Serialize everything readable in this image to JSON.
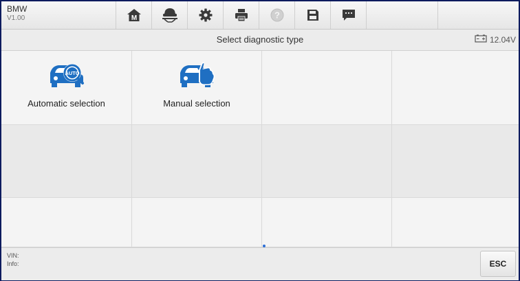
{
  "header": {
    "vehicle": "BMW",
    "version": "V1.00",
    "buttons": [
      {
        "icon": "home-icon"
      },
      {
        "icon": "vehicle-lift-icon"
      },
      {
        "icon": "gear-icon"
      },
      {
        "icon": "printer-icon"
      },
      {
        "icon": "help-icon"
      },
      {
        "icon": "save-icon"
      },
      {
        "icon": "message-icon"
      }
    ]
  },
  "titlebar": {
    "title": "Select diagnostic type",
    "battery_voltage": "12.04V"
  },
  "options": [
    {
      "label": "Automatic selection",
      "icon": "auto-car-icon"
    },
    {
      "label": "Manual selection",
      "icon": "manual-car-icon"
    }
  ],
  "footer": {
    "vin_label": "VIN:",
    "info_label": "Info:",
    "esc_label": "ESC"
  },
  "colors": {
    "frame_border": "#0d1b5e",
    "icon_blue": "#1f6fc2",
    "icon_dark": "#3a3a3a"
  }
}
